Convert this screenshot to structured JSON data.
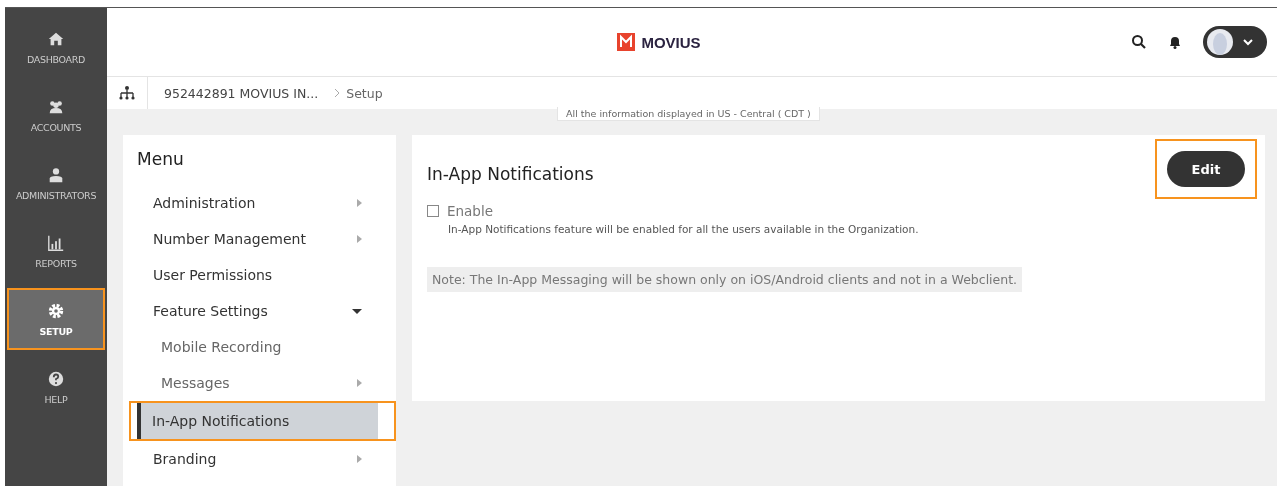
{
  "nav": [
    {
      "label": "DASHBOARD",
      "kind": "home",
      "selected": false,
      "highlighted": false
    },
    {
      "label": "ACCOUNTS",
      "kind": "accounts",
      "selected": false,
      "highlighted": false
    },
    {
      "label": "ADMINISTRATORS",
      "kind": "admins",
      "selected": false,
      "highlighted": false
    },
    {
      "label": "REPORTS",
      "kind": "reports",
      "selected": false,
      "highlighted": false
    },
    {
      "label": "SETUP",
      "kind": "setup",
      "selected": true,
      "highlighted": true
    },
    {
      "label": "HELP",
      "kind": "help",
      "selected": false,
      "highlighted": false
    }
  ],
  "header": {
    "logo": "MOVIUS"
  },
  "breadcrumb": {
    "account": "952442891 MOVIUS IN...",
    "page": "Setup"
  },
  "timezone_note": "All the information displayed in US - Central ( CDT )",
  "menu": {
    "title": "Menu",
    "items": [
      {
        "label": "Administration",
        "kind": "submenu",
        "selected": false,
        "highlighted": false
      },
      {
        "label": "Number Management",
        "kind": "submenu",
        "selected": false,
        "highlighted": false
      },
      {
        "label": "User Permissions",
        "kind": "link",
        "selected": false,
        "highlighted": false
      },
      {
        "label": "Feature Settings",
        "kind": "group",
        "expanded": true,
        "selected": false,
        "highlighted": false,
        "children": [
          {
            "label": "Mobile Recording",
            "kind": "link",
            "selected": false,
            "highlighted": false
          },
          {
            "label": "Messages",
            "kind": "submenu",
            "selected": false,
            "highlighted": false
          },
          {
            "label": "In-App Notifications",
            "kind": "link",
            "selected": true,
            "highlighted": true
          }
        ]
      },
      {
        "label": "Branding",
        "kind": "submenu",
        "selected": false,
        "highlighted": false
      }
    ]
  },
  "content": {
    "title": "In-App Notifications",
    "edit_button": {
      "label": "Edit",
      "highlighted": true
    },
    "enable": {
      "label": "Enable",
      "checked": false,
      "description": "In-App Notifications feature will be enabled for all the users available in the Organization."
    },
    "note": "Note: The In-App Messaging will be shown only on iOS/Android clients and not in a Webclient."
  }
}
